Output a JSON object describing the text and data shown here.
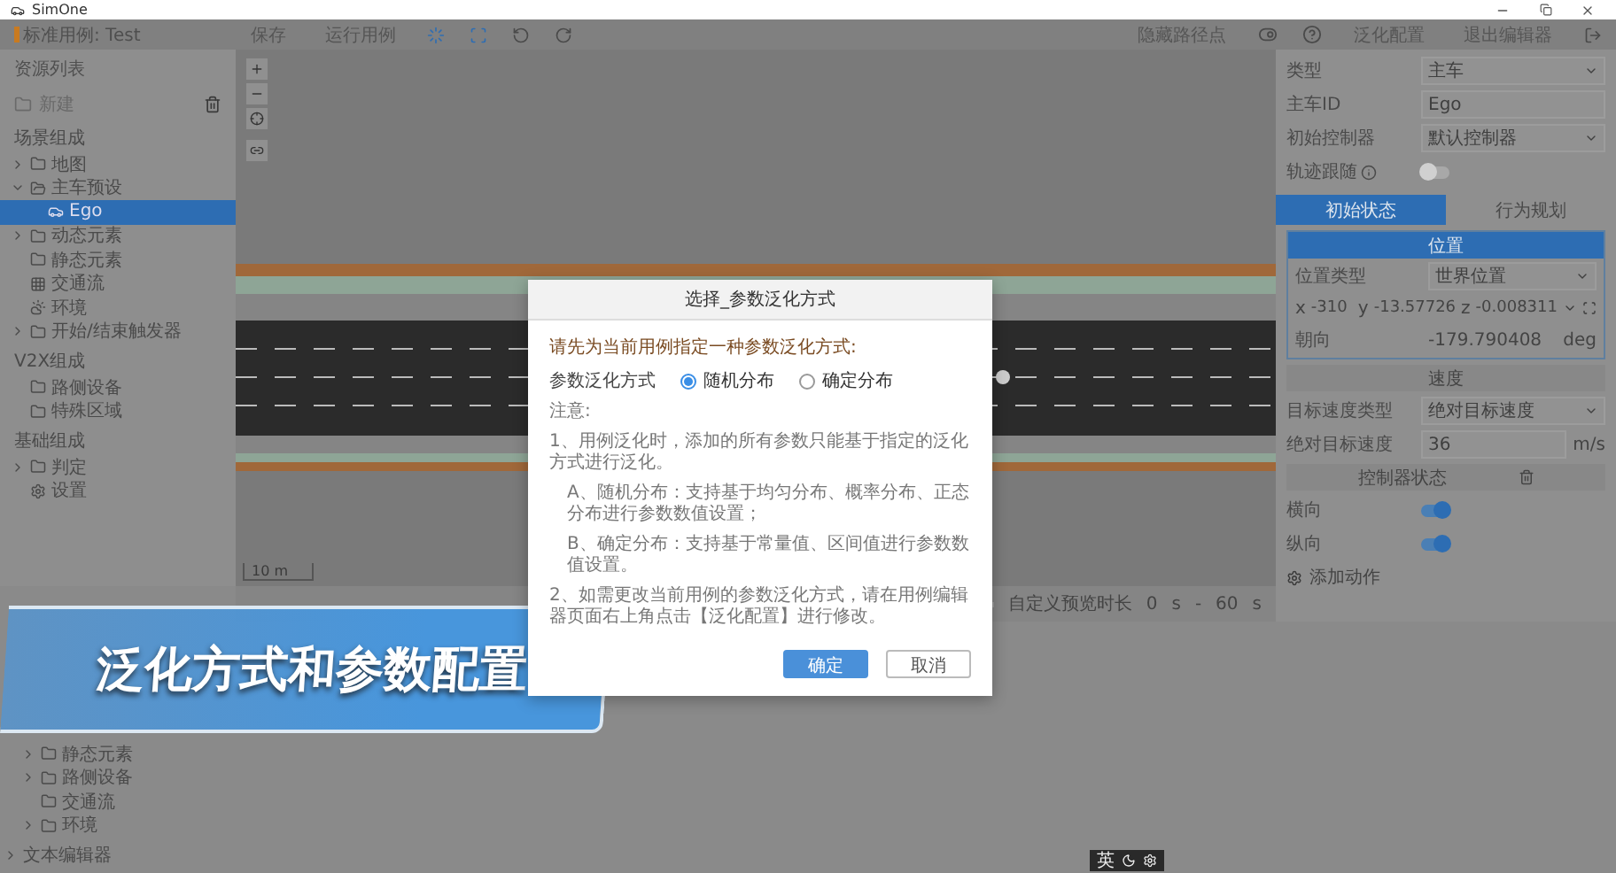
{
  "window": {
    "app_name": "SimOne"
  },
  "toolbar": {
    "case_title": "标准用例: Test",
    "buttons": [
      "保存",
      "运行用例"
    ],
    "hide_waypoints": "隐藏路径点",
    "generalize_config": "泛化配置",
    "exit_editor": "退出编辑器"
  },
  "sidebar": {
    "title": "资源列表",
    "new_button": "新建",
    "sections": [
      {
        "title": "场景组成",
        "items": [
          {
            "label": "地图",
            "kind": "folder",
            "expanded": false,
            "selected": false
          },
          {
            "label": "主车预设",
            "kind": "folder",
            "expanded": true,
            "selected": false,
            "children": [
              {
                "label": "Ego",
                "kind": "car",
                "selected": true
              }
            ]
          },
          {
            "label": "动态元素",
            "kind": "folder",
            "expanded": false,
            "selected": false
          },
          {
            "label": "静态元素",
            "kind": "folder",
            "selected": false
          },
          {
            "label": "交通流",
            "kind": "grid",
            "selected": false
          },
          {
            "label": "环境",
            "kind": "weather",
            "selected": false
          },
          {
            "label": "开始/结束触发器",
            "kind": "folder",
            "expanded": false,
            "selected": false
          }
        ]
      },
      {
        "title": "V2X组成",
        "items": [
          {
            "label": "路侧设备",
            "kind": "folder",
            "selected": false
          },
          {
            "label": "特殊区域",
            "kind": "folder",
            "selected": false
          }
        ]
      },
      {
        "title": "基础组成",
        "items": [
          {
            "label": "判定",
            "kind": "folder",
            "expanded": false,
            "selected": false
          },
          {
            "label": "设置",
            "kind": "settings",
            "selected": false
          }
        ]
      }
    ]
  },
  "canvas": {
    "scale": "10 m"
  },
  "timeline": {
    "progress": {
      "level": 0
    },
    "preview_label": "自定义预览时长",
    "start": "0",
    "start_unit": "s",
    "separator": "-",
    "end": "60",
    "end_unit": "s"
  },
  "properties": {
    "rows": [
      {
        "kind": "select",
        "label": "类型",
        "value": "主车"
      },
      {
        "kind": "input",
        "label": "主车ID",
        "value": "Ego"
      },
      {
        "kind": "select",
        "label": "初始控制器",
        "value": "默认控制器"
      },
      {
        "kind": "toggle",
        "label": "轨迹跟随",
        "on": false
      }
    ],
    "tabs": [
      {
        "label": "初始状态",
        "selected": true
      },
      {
        "label": "行为规划",
        "selected": false
      }
    ],
    "position": {
      "title": "位置",
      "type_label": "位置类型",
      "type_value": "世界位置",
      "coords": [
        {
          "axis": "x",
          "value": "-310"
        },
        {
          "axis": "y",
          "value": "-13.57726"
        },
        {
          "axis": "z",
          "value": "-0.008311"
        }
      ],
      "heading_label": "朝向",
      "heading_value": "-179.790408",
      "heading_unit": "deg"
    },
    "speed": {
      "title": "速度",
      "type_label": "目标速度类型",
      "type_value": "绝对目标速度",
      "value_label": "绝对目标速度",
      "value": "36",
      "unit": "m/s"
    },
    "controller": {
      "title": "控制器状态",
      "toggles": [
        {
          "label": "横向",
          "on": true
        },
        {
          "label": "纵向",
          "on": true
        }
      ]
    },
    "add_action": "添加动作"
  },
  "dialog": {
    "title": "选择_参数泛化方式",
    "prompt": "请先为当前用例指定一种参数泛化方式:",
    "method_label": "参数泛化方式",
    "options": [
      {
        "label": "随机分布",
        "selected": true
      },
      {
        "label": "确定分布",
        "selected": false
      }
    ],
    "notes_title": "注意:",
    "notes": [
      "1、用例泛化时，添加的所有参数只能基于指定的泛化方式进行泛化。",
      "A、随机分布：支持基于均匀分布、概率分布、正态分布进行参数数值设置；",
      "B、确定分布：支持基于常量值、区间值进行参数数值设置。",
      "2、如需更改当前用例的参数泛化方式，请在用例编辑器页面右上角点击【泛化配置】进行修改。"
    ],
    "buttons": [
      {
        "label": "确定",
        "kind": "primary"
      },
      {
        "label": "取消",
        "kind": "secondary"
      }
    ]
  },
  "library": {
    "items": [
      {
        "label": "静态元素",
        "expanded": false
      },
      {
        "label": "路侧设备",
        "expanded": false
      },
      {
        "label": "交通流"
      },
      {
        "label": "环境",
        "expanded": false
      }
    ]
  },
  "text_editor": {
    "label": "文本编辑器",
    "expanded": false
  },
  "banner": {
    "text": "泛化方式和参数配置"
  },
  "ime": {
    "label": "英"
  }
}
